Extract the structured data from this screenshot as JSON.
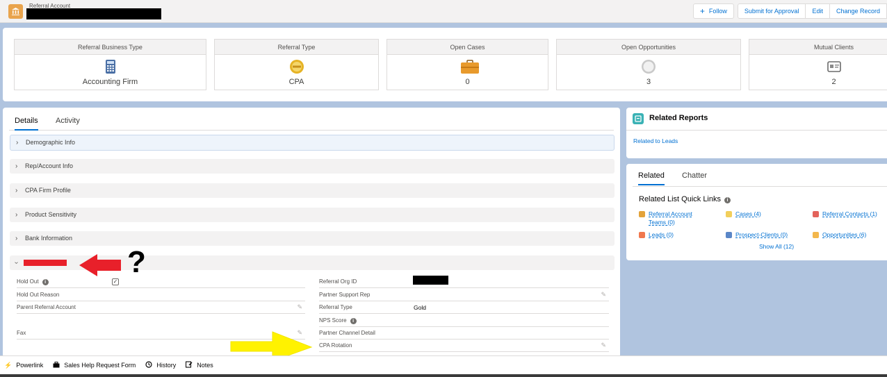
{
  "header": {
    "object_label": "Referral Account",
    "icon": "bank-icon",
    "actions": {
      "follow": "Follow",
      "submit": "Submit for Approval",
      "edit": "Edit",
      "change_record": "Change Record"
    }
  },
  "highlights": [
    {
      "title": "Referral Business Type",
      "value": "Accounting Firm",
      "icon": "calculator-icon"
    },
    {
      "title": "Referral Type",
      "value": "CPA",
      "icon": "gold-badge-icon"
    },
    {
      "title": "Open Cases",
      "value": "0",
      "icon": "briefcase-icon"
    },
    {
      "title": "Open Opportunities",
      "value": "3",
      "icon": "compass-icon"
    },
    {
      "title": "Mutual Clients",
      "value": "2",
      "icon": "id-card-icon"
    }
  ],
  "details": {
    "tabs": [
      "Details",
      "Activity"
    ],
    "sections": [
      "Demographic Info",
      "Rep/Account Info",
      "CPA Firm Profile",
      "Product Sensitivity",
      "Bank Information"
    ],
    "left_fields": {
      "hold_out": "Hold Out",
      "hold_out_reason": "Hold Out Reason",
      "parent_referral_account": "Parent Referral Account",
      "fax": "Fax"
    },
    "right_fields": {
      "referral_org_id": "Referral Org ID",
      "partner_support_rep": "Partner Support Rep",
      "referral_type_label": "Referral Type",
      "referral_type_value": "Gold",
      "nps_score": "NPS Score",
      "partner_channel_detail": "Partner Channel Detail",
      "cpa_rotation": "CPA Rotation"
    },
    "hold_out_checked": "✓",
    "annotation_question": "?"
  },
  "related_reports": {
    "title": "Related Reports",
    "link": "Related to Leads"
  },
  "related": {
    "tabs": [
      "Related",
      "Chatter"
    ],
    "quick_links_title": "Related List Quick Links",
    "links": [
      {
        "label": "Referral Account",
        "label2": "Teams (0)",
        "color": "#e3a33b"
      },
      {
        "label": "Cases (4)",
        "color": "#f2cf5b"
      },
      {
        "label": "Referral Contacts (1)",
        "color": "#e3635b"
      },
      {
        "label": "Leads (0)",
        "color": "#f0784e"
      },
      {
        "label": "Prospect-Clients (0)",
        "color": "#5a86c7"
      },
      {
        "label": "Opportunities (6)",
        "color": "#f3b74c"
      }
    ],
    "show_all": "Show All (12)"
  },
  "footer": [
    {
      "label": "Powerlink",
      "icon": "lightning-icon"
    },
    {
      "label": "Sales Help Request Form",
      "icon": "briefcase-icon"
    },
    {
      "label": "History",
      "icon": "clock-icon"
    },
    {
      "label": "Notes",
      "icon": "notes-icon"
    }
  ],
  "colors": {
    "brand_blue": "#0070d2",
    "page_bg": "#b0c4df",
    "annotation_red": "#e8202a",
    "annotation_yellow": "#fff200"
  }
}
